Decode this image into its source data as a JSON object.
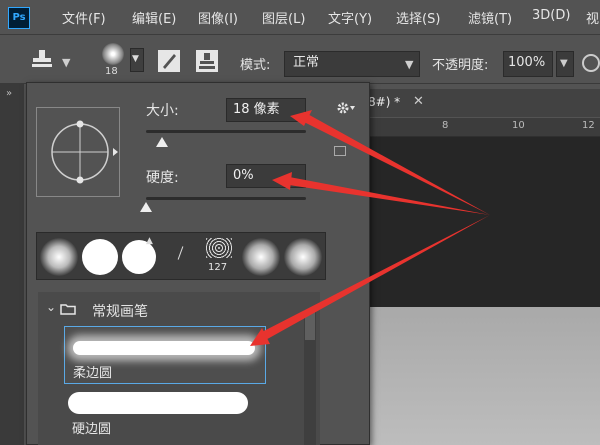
{
  "app": {
    "logo": "Ps"
  },
  "menu": [
    "文件(F)",
    "编辑(E)",
    "图像(I)",
    "图层(L)",
    "文字(Y)",
    "选择(S)",
    "滤镜(T)",
    "3D(D)",
    "视"
  ],
  "options": {
    "brush_size_badge": "18",
    "mode_label": "模式:",
    "mode_value": "正常",
    "opacity_label": "不透明度:",
    "opacity_value": "100%"
  },
  "document": {
    "tab_title": "8#) *",
    "ruler_ticks": [
      "8",
      "10",
      "12"
    ]
  },
  "brush_panel": {
    "size_label": "大小:",
    "size_value": "18 像素",
    "hardness_label": "硬度:",
    "hardness_value": "0%",
    "size_slider_fraction": 0.1,
    "hardness_slider_fraction": 0.0,
    "preset_count_label": "127",
    "group_name": "常规画笔",
    "brushes": [
      {
        "name": "柔边圆",
        "selected": true
      },
      {
        "name": "硬边圆",
        "selected": false
      }
    ]
  },
  "colors": {
    "annotation_arrow": "#e8332e",
    "selection_border": "#5aa9e6",
    "panel_bg": "#535353"
  },
  "icons": [
    "stamp-tool-icon",
    "brush-toggle-icon",
    "stamp-clone-icon",
    "gear-icon",
    "folder-icon",
    "chevron-down-icon",
    "close-icon"
  ]
}
